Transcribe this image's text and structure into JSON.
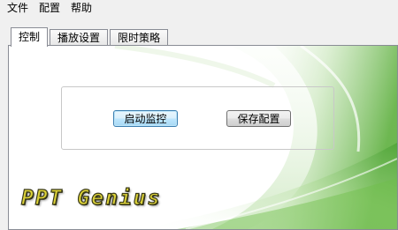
{
  "menubar": {
    "items": [
      "文件",
      "配置",
      "帮助"
    ]
  },
  "tabs": [
    {
      "label": "控制",
      "active": true
    },
    {
      "label": "播放设置",
      "active": false
    },
    {
      "label": "限时策略",
      "active": false
    }
  ],
  "control_panel": {
    "start_button": "启动监控",
    "save_button": "保存配置"
  },
  "logo": {
    "text": "PPT Genius"
  },
  "colors": {
    "accent_green": "#6fbf4a",
    "logo_yellow": "#dcd238"
  }
}
